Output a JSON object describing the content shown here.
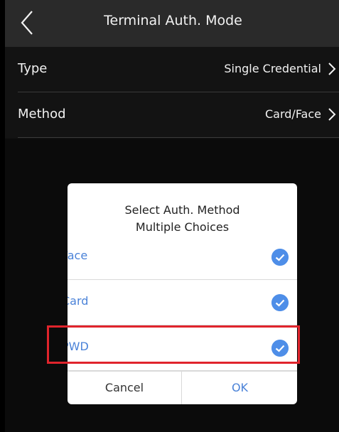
{
  "header": {
    "title": "Terminal Auth. Mode",
    "back_icon": "chevron-left-icon"
  },
  "settings": [
    {
      "label": "Type",
      "value": "Single Credential"
    },
    {
      "label": "Method",
      "value": "Card/Face"
    }
  ],
  "dialog": {
    "title_line1": "Select Auth. Method",
    "title_line2": "Multiple Choices",
    "options": [
      {
        "label": "Face",
        "checked": true
      },
      {
        "label": "Card",
        "checked": true
      },
      {
        "label": "PWD",
        "checked": true
      }
    ],
    "cancel_label": "Cancel",
    "ok_label": "OK"
  },
  "colors": {
    "accent": "#4e8ee8",
    "highlight": "#e0242c",
    "header_bg": "#2a2a2a",
    "screen_bg": "#131313"
  }
}
